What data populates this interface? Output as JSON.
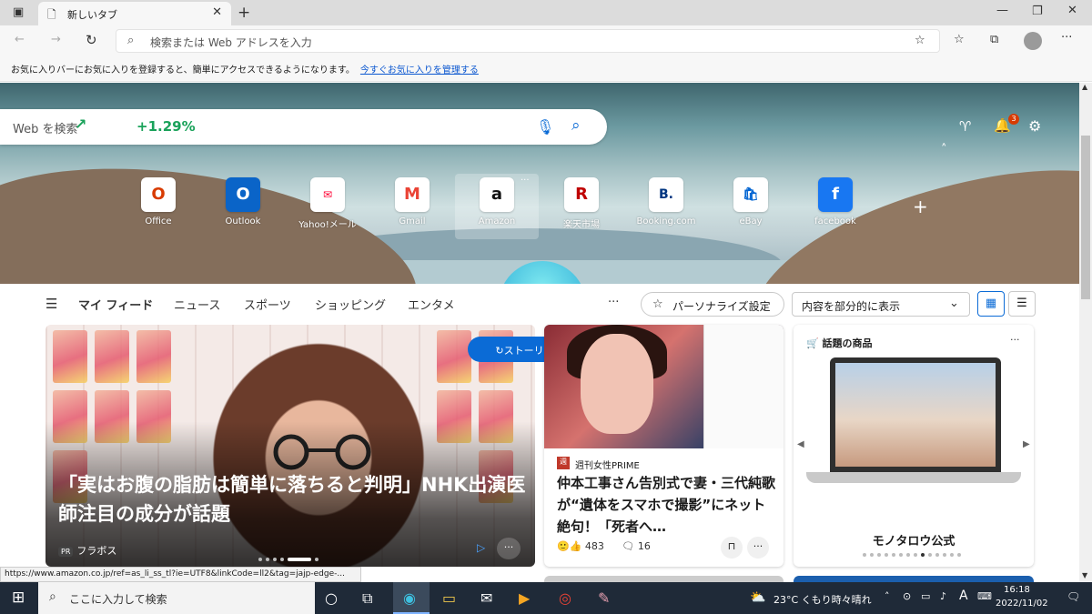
{
  "browser": {
    "tab_title": "新しいタブ",
    "address_placeholder": "検索または Web アドレスを入力",
    "favorites_message": "お気に入りバーにお気に入りを登録すると、簡単にアクセスできるようになります。",
    "favorites_link": "今すぐお気に入りを管理する"
  },
  "hero": {
    "search_placeholder": "Web を検索",
    "stock_change": "+1.29%",
    "notification_count": "3",
    "quick_links": [
      {
        "label": "Office",
        "icon": "office-icon",
        "color": "#d83b01"
      },
      {
        "label": "Outlook",
        "icon": "outlook-icon",
        "color": "#0a64c8"
      },
      {
        "label": "Yahoo!メール",
        "icon": "yahoo-mail-icon",
        "color": "#ff0033"
      },
      {
        "label": "Gmail",
        "icon": "gmail-icon",
        "color": "#ea4335"
      },
      {
        "label": "Amazon",
        "icon": "amazon-icon",
        "color": "#111111"
      },
      {
        "label": "楽天市場",
        "icon": "rakuten-icon",
        "color": "#bf0000"
      },
      {
        "label": "Booking.com",
        "icon": "booking-icon",
        "color": "#003580"
      },
      {
        "label": "eBay",
        "icon": "ebay-icon",
        "color": "#0064d2"
      },
      {
        "label": "facebook",
        "icon": "facebook-icon",
        "color": "#1877f2"
      }
    ]
  },
  "feed": {
    "nav": [
      "マイ フィード",
      "ニュース",
      "スポーツ",
      "ショッピング",
      "エンタメ"
    ],
    "personalize": "パーソナライズ設定",
    "layout_select": "内容を部分的に表示",
    "story_update": "ストーリーの更新"
  },
  "main_story": {
    "headline": "「実はお腹の脂肪は簡単に落ちると判明」NHK出演医師注目の成分が話題",
    "pr_badge": "PR",
    "source": "フラボス"
  },
  "story2": {
    "source": "週刊女性PRIME",
    "headline": "仲本工事さん告別式で妻・三代純歌が“遺体をスマホで撮影”にネット絶句！「死者へ…",
    "reactions": "483",
    "comments": "16"
  },
  "shopping": {
    "title": "話題の商品",
    "product_name": "モノタロウ公式"
  },
  "status_url": "https://www.amazon.co.jp/ref=as_li_ss_tl?ie=UTF8&linkCode=ll2&tag=jajp-edge-...",
  "taskbar": {
    "search_placeholder": "ここに入力して検索",
    "weather": "23°C くもり時々晴れ",
    "ime": "A",
    "time": "16:18",
    "date": "2022/11/02"
  }
}
